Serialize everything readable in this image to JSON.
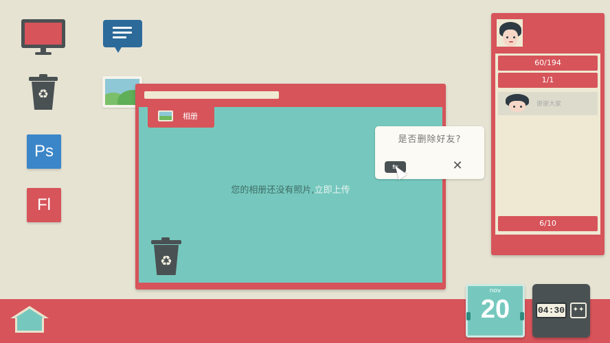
{
  "desktop": {
    "icons": [
      {
        "name": "monitor-icon"
      },
      {
        "name": "chat-icon"
      },
      {
        "name": "trash-icon"
      },
      {
        "name": "photo-icon"
      }
    ],
    "ps_label": "Ps",
    "fl_label": "Fl"
  },
  "album": {
    "tab_label": "相册",
    "empty_text": "您的相册还没有照片,",
    "upload_link": "立即上传"
  },
  "confirm": {
    "question": "是否删除好友?",
    "ok_icon": "toggle-icon",
    "close_label": "✕"
  },
  "friends": {
    "count": "60/194",
    "page": "1/1",
    "friend_name": "谢谢大家",
    "bottom": "6/10"
  },
  "calendar": {
    "month": "nov",
    "day": "20"
  },
  "clock": {
    "time": "04:30",
    "stars": "✦✦"
  },
  "colors": {
    "background": "#e6e3d3",
    "accent_red": "#d6545a",
    "teal": "#76c8be",
    "dark": "#4a5153",
    "blue": "#2c6a9a"
  }
}
